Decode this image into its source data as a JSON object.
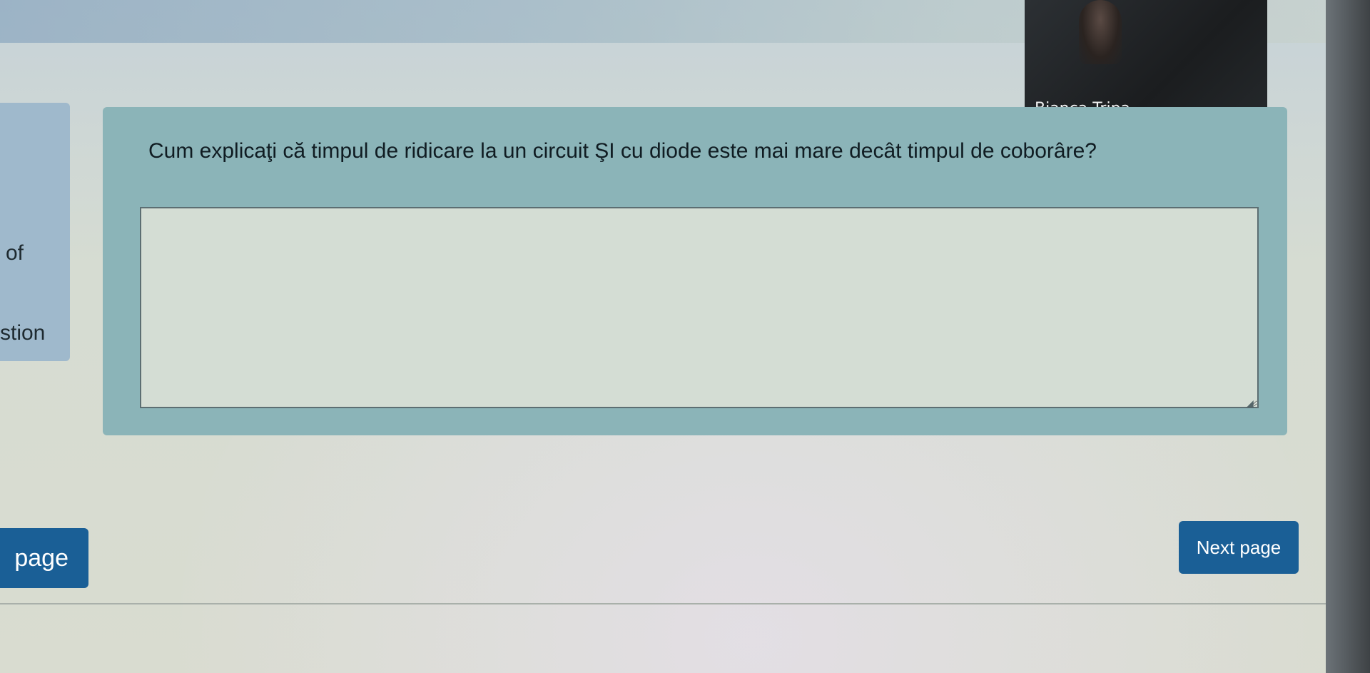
{
  "video": {
    "participant_name": "Bianca Tripa"
  },
  "sidebar": {
    "card_text_1": "of",
    "card_text_2": "stion"
  },
  "question": {
    "text": "Cum explicaţi că timpul de ridicare la un circuit ŞI cu diode este mai mare decât timpul de coborâre?",
    "answer_value": ""
  },
  "navigation": {
    "previous_label": "page",
    "next_label": "Next page"
  },
  "colors": {
    "button_blue": "#1a5f96",
    "panel_teal": "#8bb4b8"
  }
}
